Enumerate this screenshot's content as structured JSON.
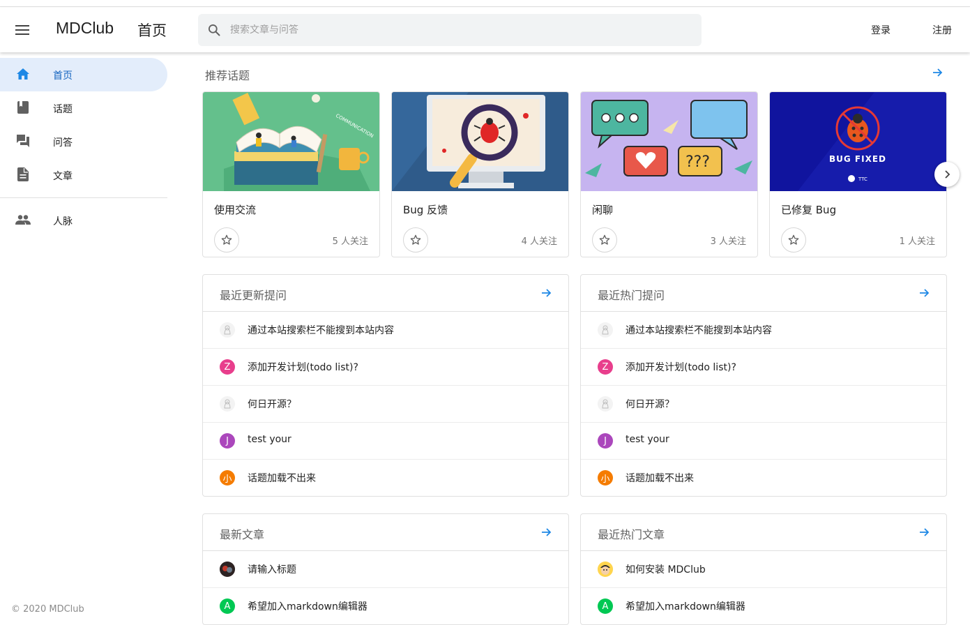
{
  "header": {
    "brand": "MDClub",
    "page_name": "首页",
    "search_placeholder": "搜索文章与问答",
    "login": "登录",
    "register": "注册"
  },
  "sidebar": {
    "items": [
      {
        "label": "首页",
        "icon": "home-icon",
        "active": true
      },
      {
        "label": "话题",
        "icon": "book-icon"
      },
      {
        "label": "问答",
        "icon": "forum-icon"
      },
      {
        "label": "文章",
        "icon": "article-icon"
      },
      {
        "label": "人脉",
        "icon": "people-icon"
      }
    ],
    "footer": "© 2020 MDClub"
  },
  "recommended": {
    "title": "推荐话题",
    "topics": [
      {
        "name": "使用交流",
        "followers": "5 人关注",
        "image": "books-illustration"
      },
      {
        "name": "Bug 反馈",
        "followers": "4 人关注",
        "image": "bug-magnifier-illustration"
      },
      {
        "name": "闲聊",
        "followers": "3 人关注",
        "image": "chat-bubbles-illustration"
      },
      {
        "name": "已修复 Bug",
        "followers": "1 人关注",
        "image": "bug-fixed-illustration",
        "image_text": "BUG FIXED",
        "image_small_text": "TTC"
      }
    ]
  },
  "panels": {
    "recent_questions": {
      "title": "最近更新提问",
      "items": [
        {
          "text": "通过本站搜索栏不能搜到本站内容",
          "avatar": "sketch"
        },
        {
          "text": "添加开发计划(todo list)?",
          "avatar": "Z",
          "color": "#e83e8c"
        },
        {
          "text": "何日开源？",
          "avatar": "sketch"
        },
        {
          "text": "test your",
          "avatar": "J",
          "color": "#ab47bc"
        },
        {
          "text": "话题加载不出来",
          "avatar": "小",
          "color": "#f57c00"
        }
      ]
    },
    "hot_questions": {
      "title": "最近热门提问",
      "items": [
        {
          "text": "通过本站搜索栏不能搜到本站内容",
          "avatar": "sketch"
        },
        {
          "text": "添加开发计划(todo list)?",
          "avatar": "Z",
          "color": "#e83e8c"
        },
        {
          "text": "何日开源？",
          "avatar": "sketch"
        },
        {
          "text": "test your",
          "avatar": "J",
          "color": "#ab47bc"
        },
        {
          "text": "话题加载不出来",
          "avatar": "小",
          "color": "#f57c00"
        }
      ]
    },
    "new_articles": {
      "title": "最新文章",
      "items": [
        {
          "text": "请输入标题",
          "avatar": "photo"
        },
        {
          "text": "希望加入markdown编辑器",
          "avatar": "A",
          "color": "#00c853"
        }
      ]
    },
    "hot_articles": {
      "title": "最近热门文章",
      "items": [
        {
          "text": "如何安装 MDClub",
          "avatar": "face"
        },
        {
          "text": "希望加入markdown编辑器",
          "avatar": "A",
          "color": "#00c853"
        }
      ]
    }
  },
  "colors": {
    "accent": "#1e88e5",
    "active_nav_bg": "#e3edfb"
  }
}
